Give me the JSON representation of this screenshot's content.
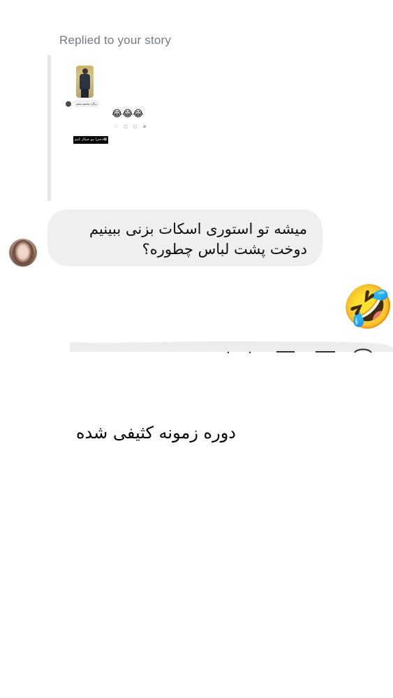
{
  "reply": {
    "label": "Replied to your story"
  },
  "story_preview": {
    "pill_text": "برگرد پشتتو ببینیم",
    "emojis": "😂😂😂",
    "icons": "♡ ▢ ▢ ⊕",
    "black_label": "دخترا ببو چیکار کنیم😂"
  },
  "message_in": {
    "text": "میشه تو استوری اسکات بزنی ببینیم دوخت پشت لباس چطوره؟"
  },
  "message_out": {
    "emoji": "🤣"
  },
  "caption": {
    "text": "دوره زمونه کثیفی شده"
  }
}
